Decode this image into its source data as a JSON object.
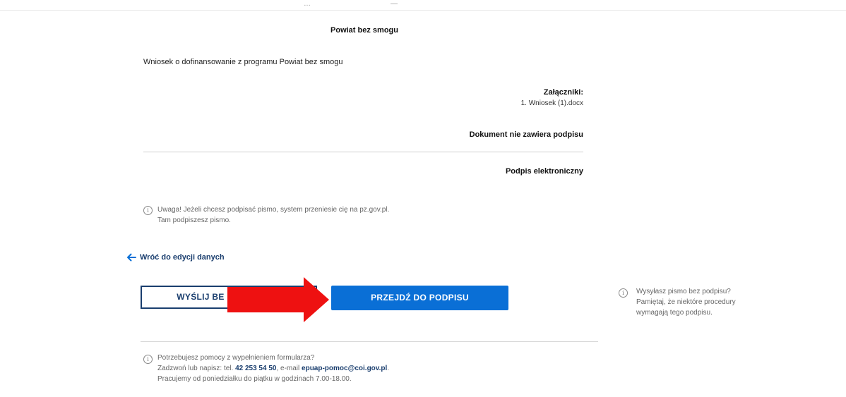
{
  "page": {
    "top_fragments": [
      "…",
      "—"
    ]
  },
  "document": {
    "title": "Powiat bez smogu",
    "body": "Wniosek o dofinansowanie z programu Powiat bez smogu",
    "attachments_header": "Załączniki:",
    "attachments": [
      "1. Wniosek (1).docx"
    ],
    "signature_status": "Dokument nie zawiera podpisu",
    "electronic_signature_label": "Podpis elektroniczny"
  },
  "notice": {
    "icon": "info-icon",
    "lines": [
      "Uwaga! Jeżeli chcesz podpisać pismo, system przeniesie cię na pz.gov.pl.",
      "Tam podpiszesz pismo."
    ]
  },
  "navigation": {
    "back_label": "Wróć do edycji danych",
    "back_icon": "arrow-left-icon"
  },
  "actions": {
    "send_without_signature_visible": "WYŚLIJ BE",
    "go_to_signature": "PRZEJDŹ DO PODPISU",
    "annotation": "red-arrow-icon"
  },
  "side_note": {
    "icon": "info-icon",
    "lines": [
      "Wysyłasz pismo bez podpisu?",
      "Pamiętaj, że niektóre procedury",
      "wymagają tego podpisu."
    ]
  },
  "help": {
    "icon": "info-icon",
    "line1": "Potrzebujesz pomocy z wypełnieniem formularza?",
    "line2_prefix": "Zadzwoń lub napisz: tel.",
    "phone": "42 253 54 50",
    "line2_mid": ", e-mail",
    "email": "epuap-pomoc@coi.gov.pl",
    "line2_suffix": ".",
    "line3": "Pracujemy od poniedziałku do piątku w godzinach 7.00-18.00."
  },
  "colors": {
    "primary_button": "#0a6fd6",
    "navy_text": "#1a3e6e",
    "annotation_red": "#ee1111"
  }
}
